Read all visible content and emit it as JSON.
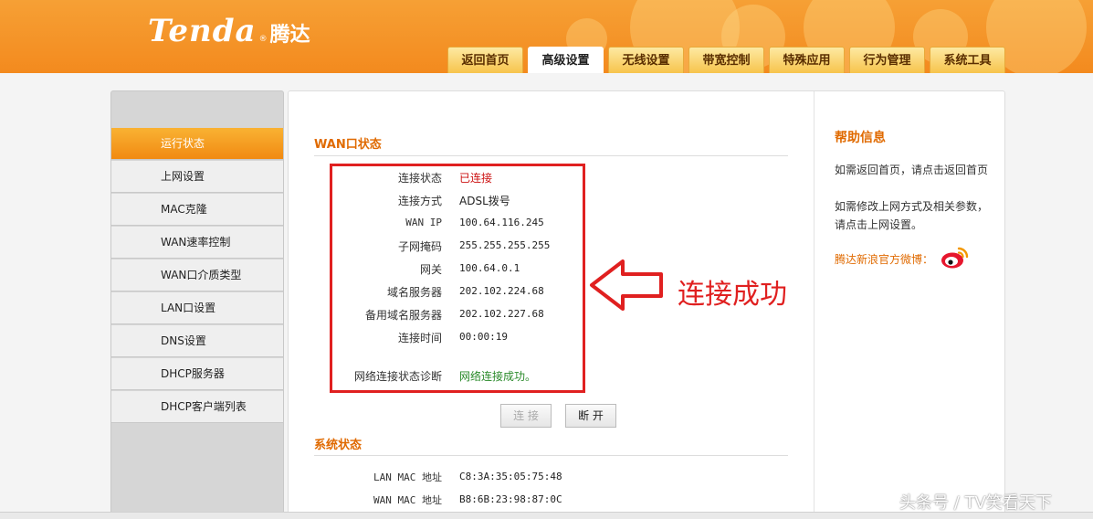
{
  "header": {
    "logo_en": "Tenda",
    "logo_reg": "®",
    "logo_cn": "腾达",
    "tabs": [
      {
        "label": "返回首页"
      },
      {
        "label": "高级设置"
      },
      {
        "label": "无线设置"
      },
      {
        "label": "带宽控制"
      },
      {
        "label": "特殊应用"
      },
      {
        "label": "行为管理"
      },
      {
        "label": "系统工具"
      }
    ],
    "active_tab": "高级设置"
  },
  "sidebar": {
    "items": [
      {
        "label": "运行状态"
      },
      {
        "label": "上网设置"
      },
      {
        "label": "MAC克隆"
      },
      {
        "label": "WAN速率控制"
      },
      {
        "label": "WAN口介质类型"
      },
      {
        "label": "LAN口设置"
      },
      {
        "label": "DNS设置"
      },
      {
        "label": "DHCP服务器"
      },
      {
        "label": "DHCP客户端列表"
      }
    ],
    "active_item": "运行状态"
  },
  "wan": {
    "title": "WAN口状态",
    "rows": [
      {
        "label": "连接状态",
        "value": "已连接"
      },
      {
        "label": "连接方式",
        "value": "ADSL拨号"
      },
      {
        "label": "WAN IP",
        "value": "100.64.116.245"
      },
      {
        "label": "子网掩码",
        "value": "255.255.255.255"
      },
      {
        "label": "网关",
        "value": "100.64.0.1"
      },
      {
        "label": "域名服务器",
        "value": "202.102.224.68"
      },
      {
        "label": "备用域名服务器",
        "value": "202.102.227.68"
      },
      {
        "label": "连接时间",
        "value": "00:00:19"
      },
      {
        "label": "网络连接状态诊断",
        "value": "网络连接成功。"
      }
    ],
    "connect_button": "连 接",
    "disconnect_button": "断 开"
  },
  "annotation": {
    "text": "连接成功",
    "color": "#e02020"
  },
  "system": {
    "title": "系统状态",
    "rows": [
      {
        "label": "LAN MAC 地址",
        "value": "C8:3A:35:05:75:48"
      },
      {
        "label": "WAN MAC 地址",
        "value": "B8:6B:23:98:87:0C"
      }
    ]
  },
  "help": {
    "title": "帮助信息",
    "paragraph1": "如需返回首页，请点击返回首页",
    "paragraph2": "如需修改上网方式及相关参数，请点击上网设置。",
    "weibo_link": "腾达新浪官方微博："
  },
  "watermark": "头条号 / TV笑看天下",
  "colors": {
    "header_orange": "#f38a1e",
    "accent_orange": "#e06a00",
    "connected_red": "#cc1111",
    "success_green": "#2a8a2a"
  }
}
